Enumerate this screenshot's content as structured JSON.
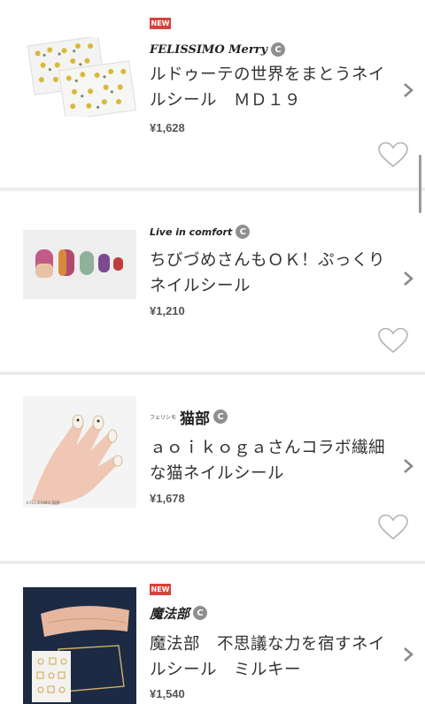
{
  "products": [
    {
      "new_label": "NEW",
      "brand": "FELISSIMO Merry",
      "brand_badge": "C",
      "title": "ルドゥーテの世界をまとうネイルシール　ＭＤ１９",
      "price": "¥1,628",
      "thumb_icon": "floral-nail-sticker-sheet",
      "chevron_icon": "chevron-right-icon",
      "heart_icon": "heart-outline-icon"
    },
    {
      "brand": "Live in comfort",
      "brand_badge": "C",
      "title": "ちびづめさんもＯＫ！ぷっくりネイルシール",
      "price": "¥1,210",
      "thumb_icon": "colorful-nail-tips",
      "chevron_icon": "chevron-right-icon",
      "heart_icon": "heart-outline-icon"
    },
    {
      "brand_small": "フェリシモ",
      "brand": "猫部",
      "brand_badge": "C",
      "title": "ａｏｉｋｏｇａさんコラボ繊細な猫ネイルシール",
      "price": "¥1,678",
      "thumb_caption": "©FELISSIMO 猫部",
      "thumb_icon": "hand-with-nails",
      "chevron_icon": "chevron-right-icon",
      "heart_icon": "heart-outline-icon"
    },
    {
      "new_label": "NEW",
      "brand": "魔法部",
      "brand_badge": "C",
      "title": "魔法部　不思議な力を宿すネイルシール　ミルキー",
      "price": "¥1,540",
      "thumb_icon": "hands-on-dark-background",
      "chevron_icon": "chevron-right-icon",
      "heart_icon": "heart-outline-icon"
    }
  ],
  "colors": {
    "new_badge": "#d9413b",
    "separator": "#ececec",
    "text": "#333333",
    "price": "#555555",
    "brand_badge": "#8f8f8f"
  }
}
